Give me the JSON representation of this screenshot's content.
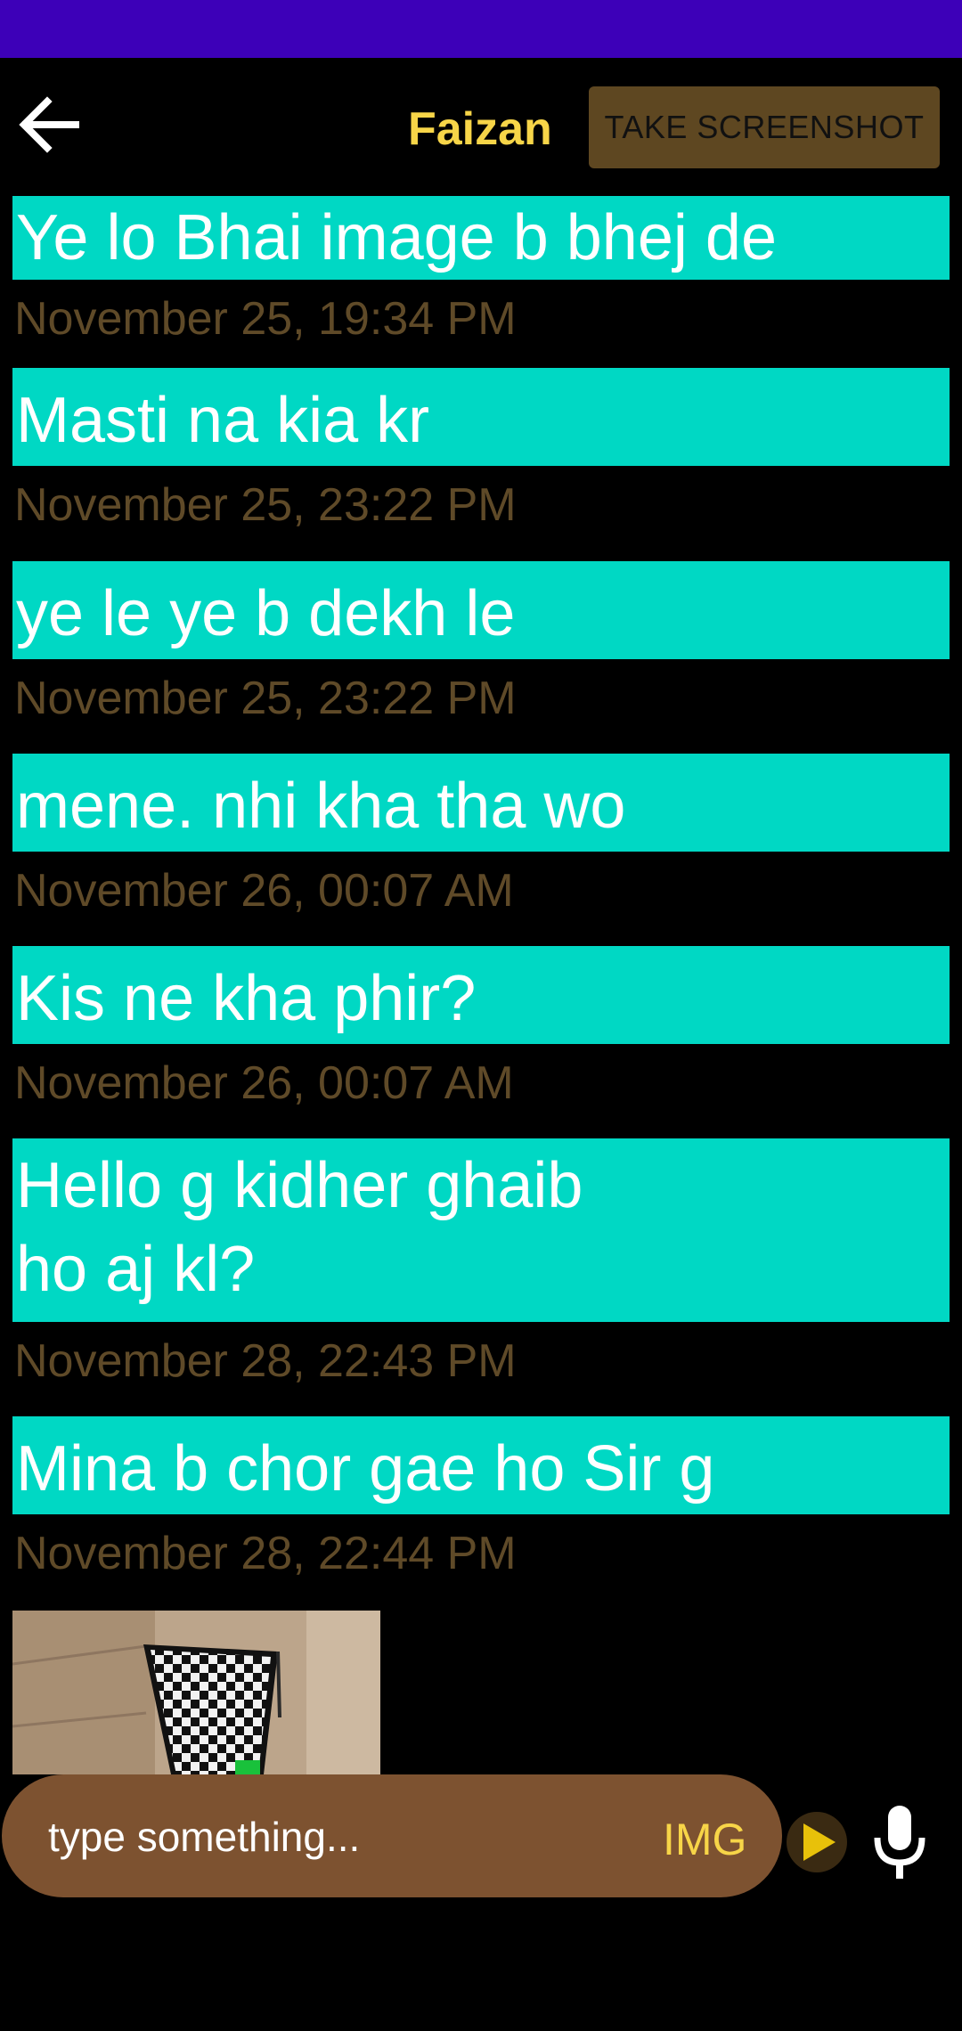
{
  "header": {
    "back_icon": "arrow-left-icon",
    "contact_name": "Faizan",
    "screenshot_label": "TAKE SCREENSHOT"
  },
  "messages": [
    {
      "text": "Ye lo Bhai image b bhej de",
      "timestamp": "November 25, 19:34 PM"
    },
    {
      "text": "Masti na kia kr",
      "timestamp": "November 25, 23:22 PM"
    },
    {
      "text": "ye le ye b dekh le",
      "timestamp": "November 25, 23:22 PM"
    },
    {
      "text": "mene. nhi kha tha wo",
      "timestamp": "November 26, 00:07 AM"
    },
    {
      "text": "Kis ne kha phir?",
      "timestamp": "November 26, 00:07 AM"
    },
    {
      "text": "Hello g kidher ghaib",
      "text_line2": "ho aj kl?",
      "timestamp": "November 28, 22:43 PM"
    },
    {
      "text": "Mina b chor gae ho Sir g",
      "timestamp": "November 28, 22:44 PM"
    }
  ],
  "composer": {
    "placeholder": "type something...",
    "img_label": "IMG",
    "send_icon": "play-triangle-icon",
    "mic_icon": "microphone-icon"
  },
  "colors": {
    "status_bar": "#3d00b8",
    "bubble": "#00d8c4",
    "name": "#f7d548",
    "timestamp": "#5f4a28",
    "input_pill": "#7d5230",
    "screenshot_button": "#5e4721"
  }
}
